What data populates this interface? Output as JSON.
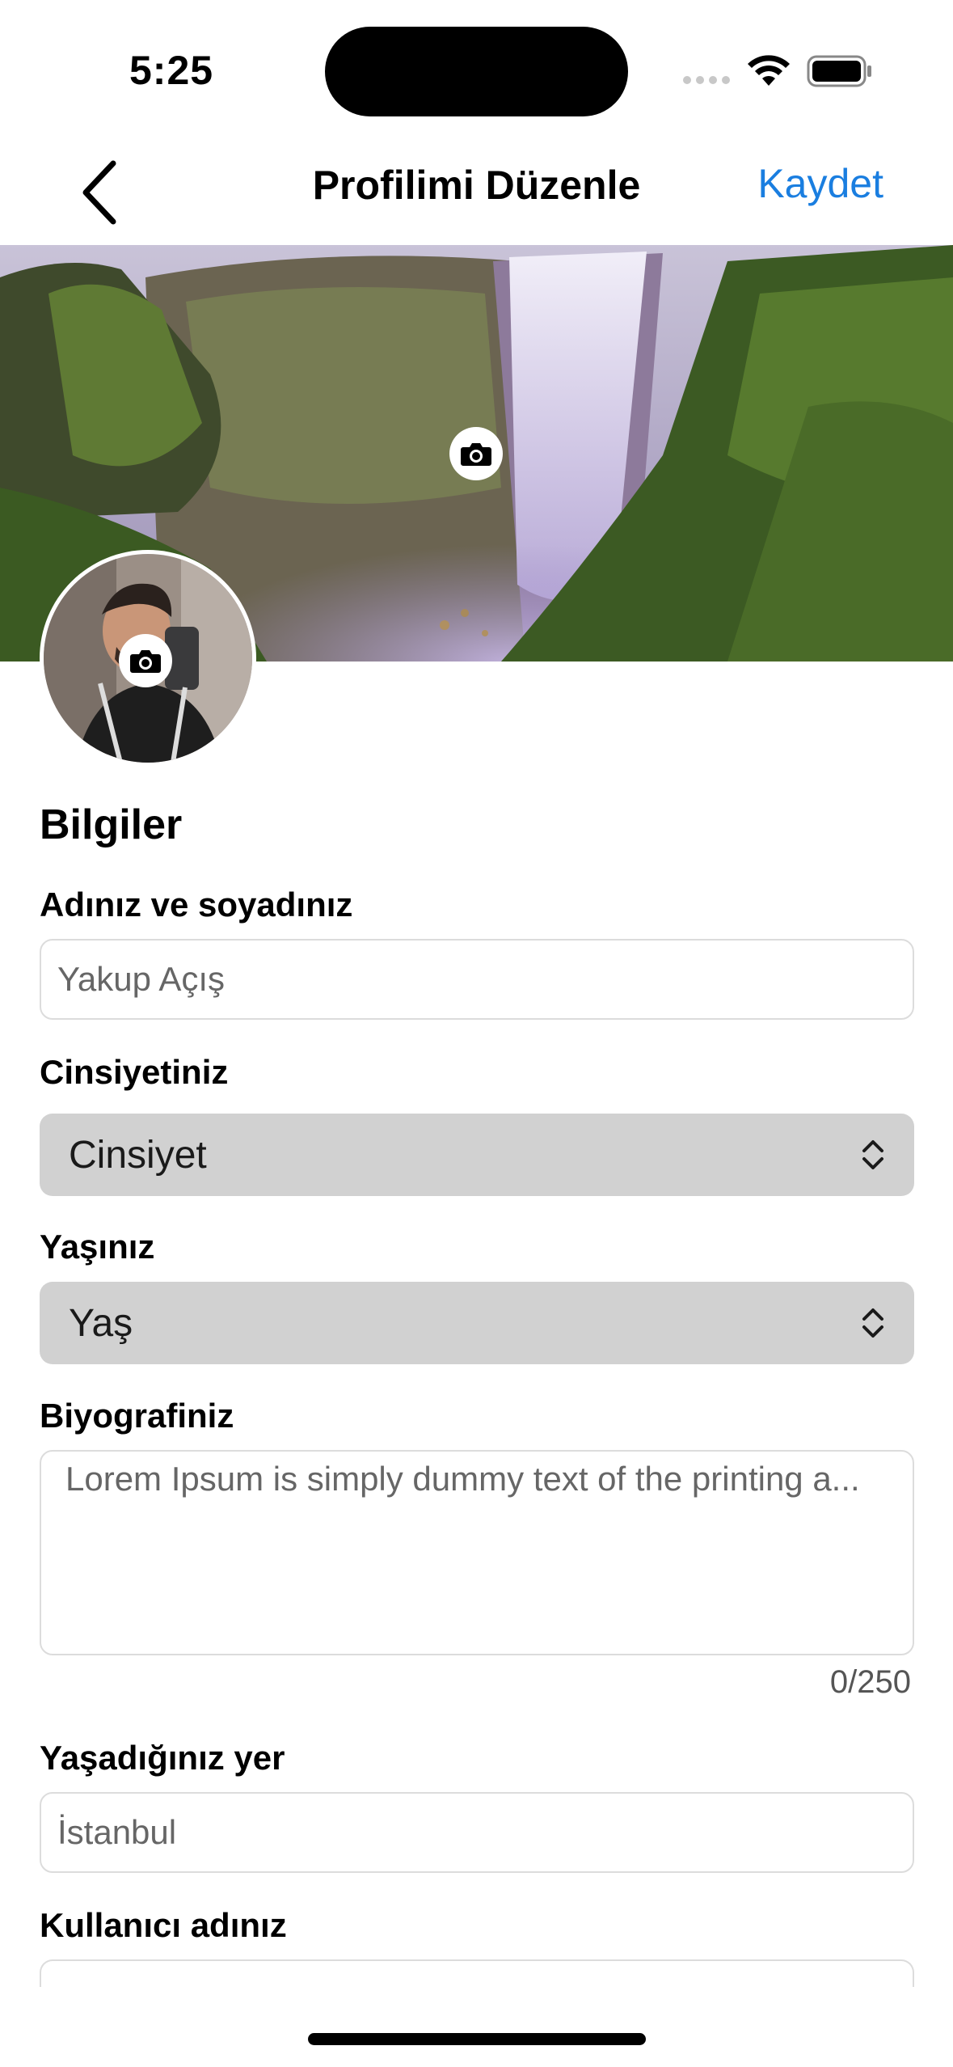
{
  "status_bar": {
    "time": "5:25"
  },
  "nav": {
    "title": "Profilimi Düzenle",
    "save_label": "Kaydet",
    "accent_color": "#1a7ee0"
  },
  "icons": {
    "back": "chevron-left-icon",
    "cover_camera": "camera-icon",
    "avatar_camera": "camera-icon",
    "select_arrows": "chevron-up-down-icon"
  },
  "form": {
    "section_title": "Bilgiler",
    "name": {
      "label": "Adınız ve soyadınız",
      "placeholder": "Yakup Açış"
    },
    "gender": {
      "label": "Cinsiyetiniz",
      "value": "Cinsiyet"
    },
    "age": {
      "label": "Yaşınız",
      "value": "Yaş"
    },
    "bio": {
      "label": "Biyografiniz",
      "placeholder": "Lorem Ipsum is simply dummy text of the printing a...",
      "counter": "0/250"
    },
    "location": {
      "label": "Yaşadığınız yer",
      "placeholder": "İstanbul"
    },
    "username": {
      "label": "Kullanıcı adınız",
      "placeholder": ""
    }
  }
}
